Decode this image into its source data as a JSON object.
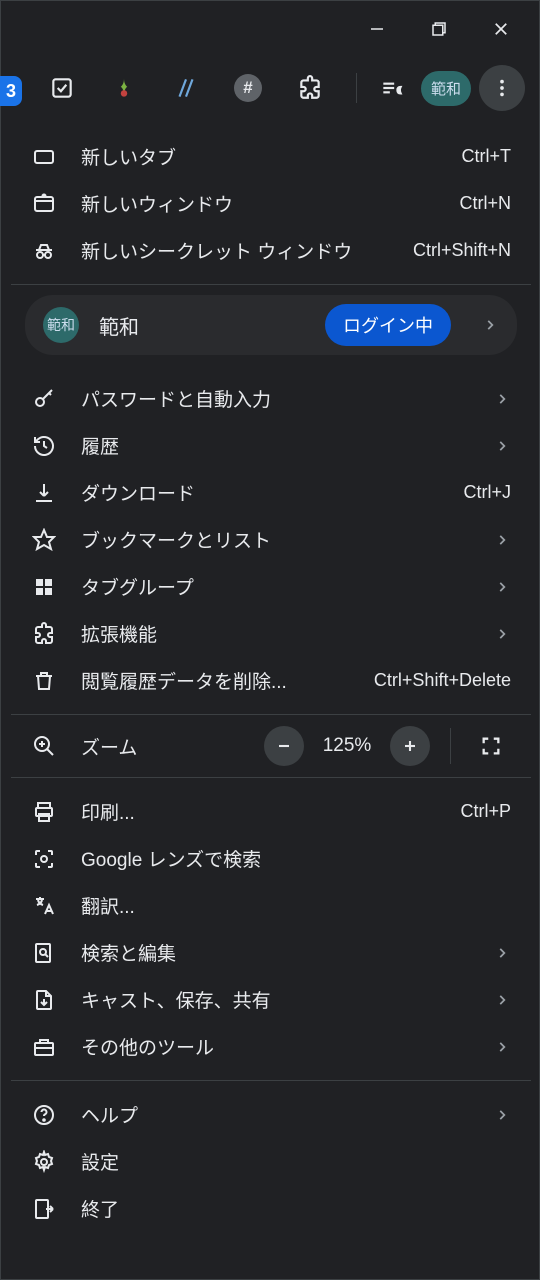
{
  "window": {
    "tab_badge": "3"
  },
  "toolbar": {
    "profile_short": "範和"
  },
  "menu": {
    "new_tab": {
      "label": "新しいタブ",
      "shortcut": "Ctrl+T"
    },
    "new_window": {
      "label": "新しいウィンドウ",
      "shortcut": "Ctrl+N"
    },
    "new_incognito": {
      "label": "新しいシークレット ウィンドウ",
      "shortcut": "Ctrl+Shift+N"
    },
    "account": {
      "avatar_short": "範和",
      "name": "範和",
      "badge": "ログイン中"
    },
    "passwords": {
      "label": "パスワードと自動入力"
    },
    "history": {
      "label": "履歴"
    },
    "downloads": {
      "label": "ダウンロード",
      "shortcut": "Ctrl+J"
    },
    "bookmarks": {
      "label": "ブックマークとリスト"
    },
    "tab_groups": {
      "label": "タブグループ"
    },
    "extensions": {
      "label": "拡張機能"
    },
    "clear_data": {
      "label": "閲覧履歴データを削除...",
      "shortcut": "Ctrl+Shift+Delete"
    },
    "zoom": {
      "label": "ズーム",
      "percent": "125%"
    },
    "print": {
      "label": "印刷...",
      "shortcut": "Ctrl+P"
    },
    "lens": {
      "label": "Google レンズで検索"
    },
    "translate": {
      "label": "翻訳..."
    },
    "find_edit": {
      "label": "検索と編集"
    },
    "cast_save_share": {
      "label": "キャスト、保存、共有"
    },
    "more_tools": {
      "label": "その他のツール"
    },
    "help": {
      "label": "ヘルプ"
    },
    "settings": {
      "label": "設定"
    },
    "exit": {
      "label": "終了"
    }
  }
}
